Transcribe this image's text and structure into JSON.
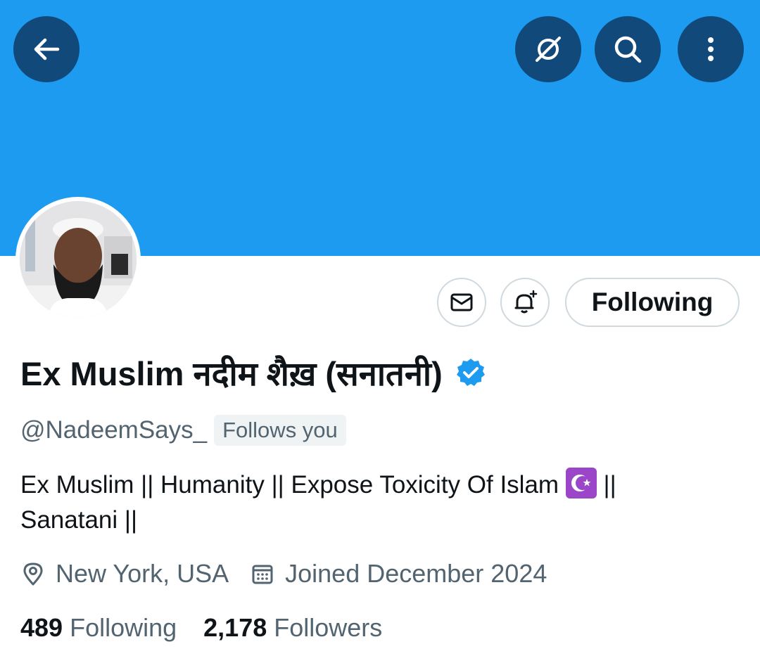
{
  "header": {
    "banner_color": "#1d9bf0",
    "back_icon": "arrow-left-icon",
    "grok_icon": "grok-icon",
    "search_icon": "search-icon",
    "more_icon": "more-vertical-icon"
  },
  "profile": {
    "display_name": "Ex Muslim नदीम शैख़ (सनातनी)",
    "verified": true,
    "handle": "@NadeemSays_",
    "follows_you": "Follows you",
    "bio_part1": "Ex Muslim || Humanity || Expose Toxicity Of Islam",
    "bio_icon": "star-and-crescent-emoji",
    "bio_part2": " ||",
    "bio_line2": "Sanatani ||",
    "location": "New York, USA",
    "joined": "Joined December 2024"
  },
  "actions": {
    "message_icon": "envelope-icon",
    "notify_icon": "bell-plus-icon",
    "following_label": "Following"
  },
  "stats": {
    "following_count": "489",
    "following_label": "Following",
    "followers_count": "2,178",
    "followers_label": "Followers"
  }
}
